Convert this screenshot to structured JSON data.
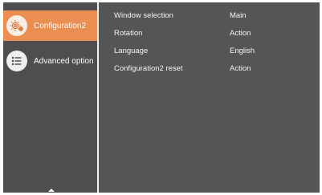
{
  "sidebar": {
    "items": [
      {
        "label": "Configuration2",
        "icon": "gear-icon",
        "selected": true
      },
      {
        "label": "Advanced option",
        "icon": "list-icon",
        "selected": false
      }
    ],
    "scroll": {
      "icon": "scroll-up-arrow-icon"
    }
  },
  "settings": [
    {
      "name": "Window selection",
      "value": "Main"
    },
    {
      "name": "Rotation",
      "value": "Action"
    },
    {
      "name": "Language",
      "value": "English"
    },
    {
      "name": "Configuration2 reset",
      "value": "Action"
    }
  ],
  "colors": {
    "panel": "#555555",
    "sidebar": "#4e4e4e",
    "accent": "#ea8e52",
    "text": "#f4f4f4"
  }
}
